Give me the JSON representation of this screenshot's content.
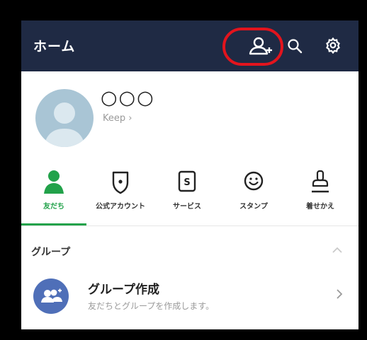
{
  "header": {
    "title": "ホーム",
    "icons": [
      "add-friend-icon",
      "search-icon",
      "gear-icon"
    ],
    "highlight_color": "#e3141d",
    "background": "#1f2a44"
  },
  "profile": {
    "name": "○○○",
    "keep_label": "Keep ›"
  },
  "nav": {
    "items": [
      {
        "label": "友だち",
        "icon": "friends-icon",
        "active": true
      },
      {
        "label": "公式アカウント",
        "icon": "official-account-icon",
        "active": false
      },
      {
        "label": "サービス",
        "icon": "services-icon",
        "active": false
      },
      {
        "label": "スタンプ",
        "icon": "stickers-icon",
        "active": false
      },
      {
        "label": "着せかえ",
        "icon": "themes-icon",
        "active": false
      }
    ],
    "accent": "#22a24a"
  },
  "groups": {
    "section_title": "グループ",
    "create": {
      "title": "グループ作成",
      "subtitle": "友だちとグループを作成します。"
    }
  }
}
